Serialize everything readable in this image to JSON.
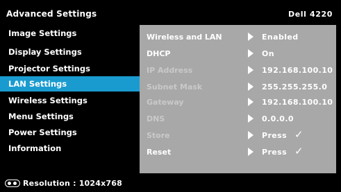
{
  "header": {
    "title": "Advanced Settings",
    "model": "Dell 4220"
  },
  "sidebar": {
    "items": [
      {
        "label": "Image Settings"
      },
      {
        "label": "Display Settings"
      },
      {
        "label": "Projector Settings"
      },
      {
        "label": "LAN Settings",
        "active": true
      },
      {
        "label": "Wireless Settings"
      },
      {
        "label": "Menu Settings"
      },
      {
        "label": "Power Settings"
      },
      {
        "label": "Information"
      }
    ]
  },
  "lan": {
    "rows": [
      {
        "label": "Wireless and LAN",
        "value": "Enabled",
        "enabled": true
      },
      {
        "label": "DHCP",
        "value": "On",
        "enabled": true
      },
      {
        "label": "IP Address",
        "value": "192.168.100.10",
        "enabled": false
      },
      {
        "label": "Subnet Mask",
        "value": "255.255.255.0",
        "enabled": false
      },
      {
        "label": "Gateway",
        "value": "192.168.100.10",
        "enabled": false
      },
      {
        "label": "DNS",
        "value": "0.0.0.0",
        "enabled": false
      },
      {
        "label": "Store",
        "value": "Press",
        "check": "✓",
        "enabled": false
      },
      {
        "label": "Reset",
        "value": "Press",
        "check": "✓",
        "enabled": true
      }
    ]
  },
  "footer": {
    "resolution_label": "Resolution :",
    "resolution_value": "1024x768",
    "icon": "monitor-input-icon"
  },
  "colors": {
    "accent": "#1a9bd0",
    "panel": "#a8a8a8",
    "background": "#000000"
  }
}
